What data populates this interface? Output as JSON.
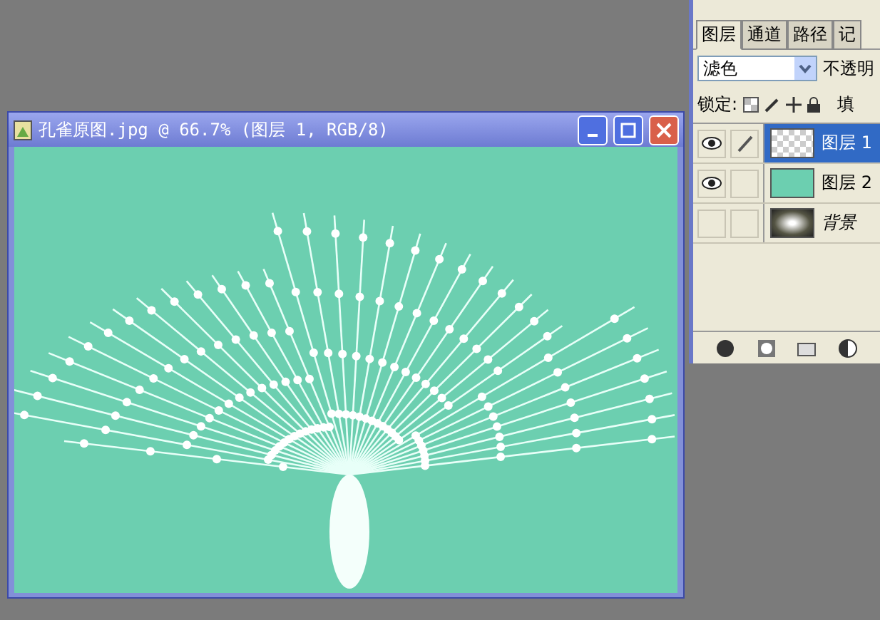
{
  "document": {
    "title": "孔雀原图.jpg @ 66.7% (图层 1, RGB/8)"
  },
  "layers_panel": {
    "tabs": [
      {
        "label": "图层",
        "selected": true
      },
      {
        "label": "通道",
        "selected": false
      },
      {
        "label": "路径",
        "selected": false
      },
      {
        "label": "记",
        "selected": false
      }
    ],
    "blend_mode": "滤色",
    "opacity_label": "不透明",
    "lock_label": "锁定:",
    "fill_label": "填",
    "layers": [
      {
        "name": "图层 1",
        "selected": true,
        "visible": true,
        "linked": true,
        "kind": "transparent"
      },
      {
        "name": "图层 2",
        "selected": false,
        "visible": true,
        "linked": false,
        "kind": "color"
      },
      {
        "name": "背景",
        "selected": false,
        "visible": false,
        "linked": false,
        "kind": "photo"
      }
    ]
  }
}
